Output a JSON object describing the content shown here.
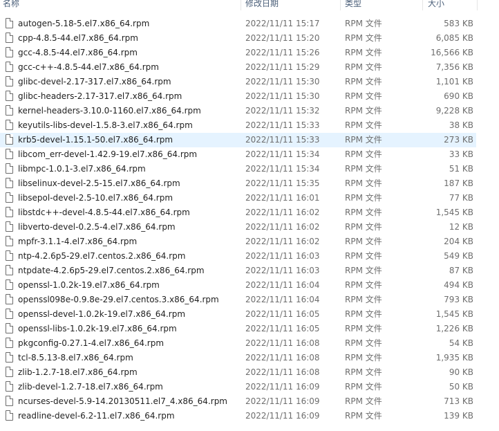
{
  "columns": {
    "name": "名称",
    "date": "修改日期",
    "type": "类型",
    "size": "大小"
  },
  "selected_index": 8,
  "files": [
    {
      "name": "autogen-5.18-5.el7.x86_64.rpm",
      "date": "2022/11/11 15:17",
      "type": "RPM 文件",
      "size": "583 KB"
    },
    {
      "name": "cpp-4.8.5-44.el7.x86_64.rpm",
      "date": "2022/11/11 15:20",
      "type": "RPM 文件",
      "size": "6,085 KB"
    },
    {
      "name": "gcc-4.8.5-44.el7.x86_64.rpm",
      "date": "2022/11/11 15:26",
      "type": "RPM 文件",
      "size": "16,566 KB"
    },
    {
      "name": "gcc-c++-4.8.5-44.el7.x86_64.rpm",
      "date": "2022/11/11 15:29",
      "type": "RPM 文件",
      "size": "7,356 KB"
    },
    {
      "name": "glibc-devel-2.17-317.el7.x86_64.rpm",
      "date": "2022/11/11 15:30",
      "type": "RPM 文件",
      "size": "1,101 KB"
    },
    {
      "name": "glibc-headers-2.17-317.el7.x86_64.rpm",
      "date": "2022/11/11 15:30",
      "type": "RPM 文件",
      "size": "690 KB"
    },
    {
      "name": "kernel-headers-3.10.0-1160.el7.x86_64.rpm",
      "date": "2022/11/11 15:32",
      "type": "RPM 文件",
      "size": "9,228 KB"
    },
    {
      "name": "keyutils-libs-devel-1.5.8-3.el7.x86_64.rpm",
      "date": "2022/11/11 15:33",
      "type": "RPM 文件",
      "size": "38 KB"
    },
    {
      "name": "krb5-devel-1.15.1-50.el7.x86_64.rpm",
      "date": "2022/11/11 15:33",
      "type": "RPM 文件",
      "size": "273 KB"
    },
    {
      "name": "libcom_err-devel-1.42.9-19.el7.x86_64.rpm",
      "date": "2022/11/11 15:34",
      "type": "RPM 文件",
      "size": "33 KB"
    },
    {
      "name": "libmpc-1.0.1-3.el7.x86_64.rpm",
      "date": "2022/11/11 15:34",
      "type": "RPM 文件",
      "size": "51 KB"
    },
    {
      "name": "libselinux-devel-2.5-15.el7.x86_64.rpm",
      "date": "2022/11/11 15:35",
      "type": "RPM 文件",
      "size": "187 KB"
    },
    {
      "name": "libsepol-devel-2.5-10.el7.x86_64.rpm",
      "date": "2022/11/11 16:01",
      "type": "RPM 文件",
      "size": "77 KB"
    },
    {
      "name": "libstdc++-devel-4.8.5-44.el7.x86_64.rpm",
      "date": "2022/11/11 16:02",
      "type": "RPM 文件",
      "size": "1,545 KB"
    },
    {
      "name": "libverto-devel-0.2.5-4.el7.x86_64.rpm",
      "date": "2022/11/11 16:02",
      "type": "RPM 文件",
      "size": "12 KB"
    },
    {
      "name": "mpfr-3.1.1-4.el7.x86_64.rpm",
      "date": "2022/11/11 16:02",
      "type": "RPM 文件",
      "size": "204 KB"
    },
    {
      "name": "ntp-4.2.6p5-29.el7.centos.2.x86_64.rpm",
      "date": "2022/11/11 16:03",
      "type": "RPM 文件",
      "size": "549 KB"
    },
    {
      "name": "ntpdate-4.2.6p5-29.el7.centos.2.x86_64.rpm",
      "date": "2022/11/11 16:03",
      "type": "RPM 文件",
      "size": "87 KB"
    },
    {
      "name": "openssl-1.0.2k-19.el7.x86_64.rpm",
      "date": "2022/11/11 16:04",
      "type": "RPM 文件",
      "size": "494 KB"
    },
    {
      "name": "openssl098e-0.9.8e-29.el7.centos.3.x86_64.rpm",
      "date": "2022/11/11 16:04",
      "type": "RPM 文件",
      "size": "793 KB"
    },
    {
      "name": "openssl-devel-1.0.2k-19.el7.x86_64.rpm",
      "date": "2022/11/11 16:05",
      "type": "RPM 文件",
      "size": "1,545 KB"
    },
    {
      "name": "openssl-libs-1.0.2k-19.el7.x86_64.rpm",
      "date": "2022/11/11 16:05",
      "type": "RPM 文件",
      "size": "1,226 KB"
    },
    {
      "name": "pkgconfig-0.27.1-4.el7.x86_64.rpm",
      "date": "2022/11/11 16:08",
      "type": "RPM 文件",
      "size": "54 KB"
    },
    {
      "name": "tcl-8.5.13-8.el7.x86_64.rpm",
      "date": "2022/11/11 16:08",
      "type": "RPM 文件",
      "size": "1,935 KB"
    },
    {
      "name": "zlib-1.2.7-18.el7.x86_64.rpm",
      "date": "2022/11/11 16:08",
      "type": "RPM 文件",
      "size": "90 KB"
    },
    {
      "name": "zlib-devel-1.2.7-18.el7.x86_64.rpm",
      "date": "2022/11/11 16:09",
      "type": "RPM 文件",
      "size": "50 KB"
    },
    {
      "name": "ncurses-devel-5.9-14.20130511.el7_4.x86_64.rpm",
      "date": "2022/11/11 16:09",
      "type": "RPM 文件",
      "size": "713 KB"
    },
    {
      "name": "readline-devel-6.2-11.el7.x86_64.rpm",
      "date": "2022/11/11 16:09",
      "type": "RPM 文件",
      "size": "139 KB"
    }
  ]
}
